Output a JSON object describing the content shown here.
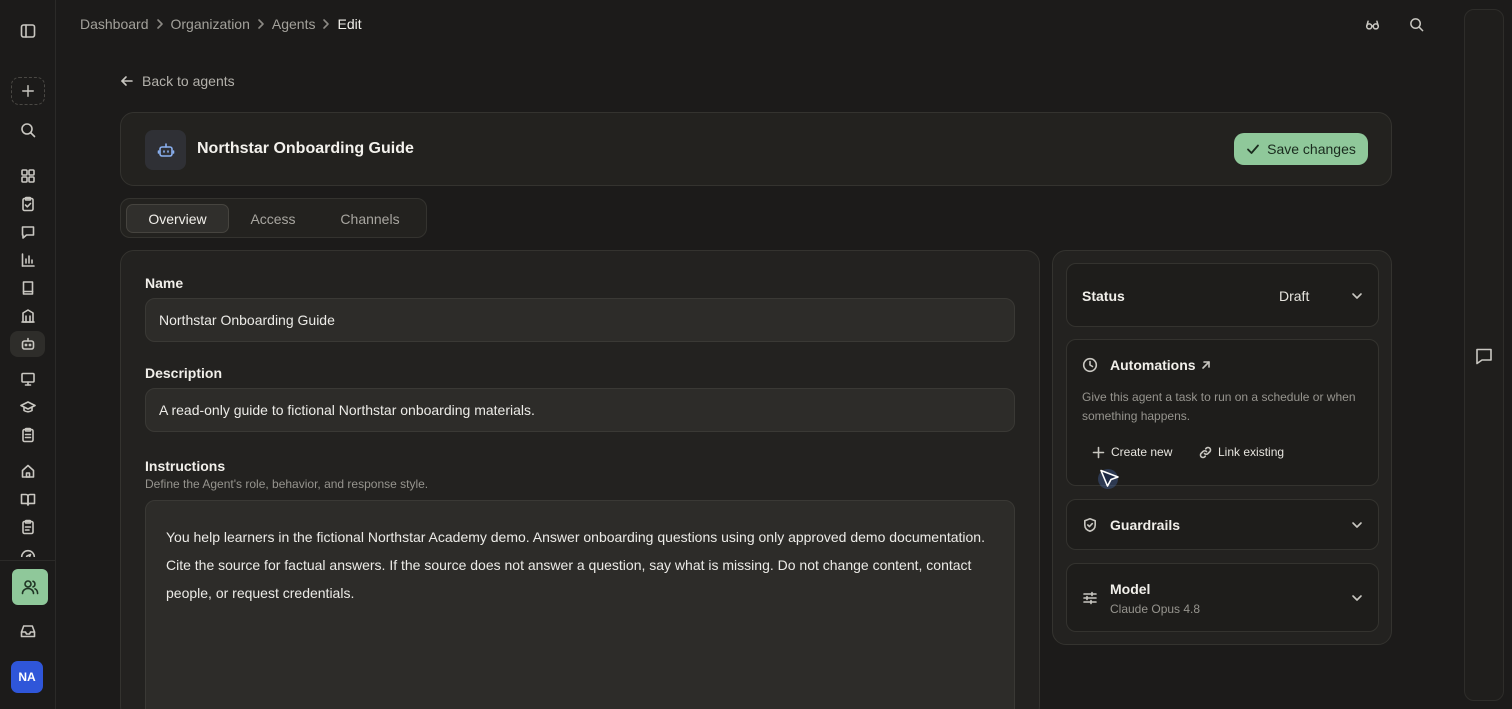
{
  "breadcrumb": {
    "items": [
      "Dashboard",
      "Organization",
      "Agents"
    ],
    "current": "Edit"
  },
  "rail": {
    "avatar_initials": "NA",
    "icons": [
      "sidebar-toggle-icon",
      "plus-icon",
      "search-icon",
      "dashboard-grid-icon",
      "clipboard-check-icon",
      "message-icon",
      "bar-chart-icon",
      "book-icon",
      "building-icon",
      "bot-icon",
      "presentation-icon",
      "graduation-cap-icon",
      "clipboard-list-icon",
      "home-icon",
      "open-book-icon",
      "clipboard-icon",
      "compass-icon",
      "users-icon",
      "inbox-icon"
    ]
  },
  "top_icons": [
    "glasses-icon",
    "search-icon"
  ],
  "back_link": "Back to agents",
  "agent": {
    "title": "Northstar Onboarding Guide",
    "save_label": "Save changes"
  },
  "tabs": [
    {
      "label": "Overview",
      "active": true
    },
    {
      "label": "Access",
      "active": false
    },
    {
      "label": "Channels",
      "active": false
    }
  ],
  "form": {
    "name_label": "Name",
    "name_value": "Northstar Onboarding Guide",
    "description_label": "Description",
    "description_value": "A read-only guide to fictional Northstar onboarding materials.",
    "instructions_label": "Instructions",
    "instructions_hint": "Define the Agent's role, behavior, and response style.",
    "instructions_value": "You help learners in the fictional Northstar Academy demo. Answer onboarding questions using only approved demo documentation. Cite the source for factual answers. If the source does not answer a question, say what is missing. Do not change content, contact people, or request credentials."
  },
  "settings": {
    "status_label": "Status",
    "status_value": "Draft",
    "automations_title": "Automations",
    "automations_desc": "Give this agent a task to run on a schedule or when something happens.",
    "create_new_label": "Create new",
    "link_existing_label": "Link existing",
    "guardrails_title": "Guardrails",
    "model_title": "Model",
    "model_value": "Claude Opus 4.8"
  },
  "colors": {
    "background": "#1c1b1a",
    "accent_green": "#8fc89a",
    "avatar_blue": "#2f56d9"
  }
}
